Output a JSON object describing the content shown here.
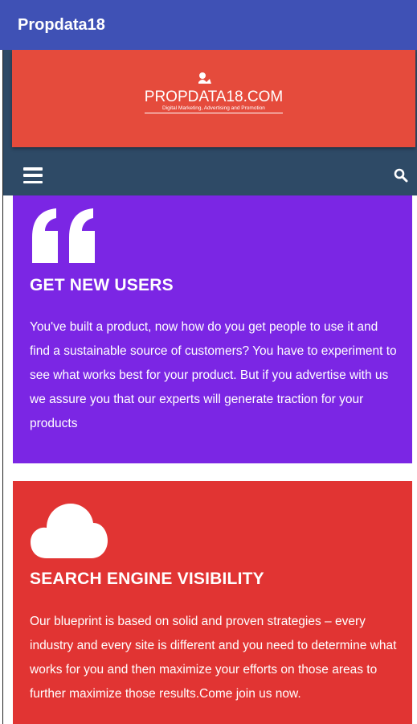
{
  "appbar": {
    "title": "Propdata18",
    "color": "#3f51b5"
  },
  "site": {
    "logo": {
      "text": "PROPDATA18.COM",
      "tagline": "Digital Marketing, Advertising and Promotion"
    },
    "banner_color": "#e54b3c",
    "nav_color": "#2e4a66",
    "nav": {
      "menu_icon": "hamburger-menu-icon",
      "search_icon": "search-icon"
    }
  },
  "cards": [
    {
      "icon": "quote-icon",
      "title": "GET NEW USERS",
      "body": "You've built a product, now how do you get people to use it and find a sustainable source of customers? You have to experiment to see what works best for your product. But if you advertise with us we assure you that our experts will generate traction for your products",
      "color": "#7b26e4"
    },
    {
      "icon": "cloud-icon",
      "title": "SEARCH ENGINE VISIBILITY",
      "body": "Our blueprint is based on solid and proven strategies – every industry and every site is different and you need to determine what works for you and then maximize your efforts on those areas to further maximize those results.Come join us now.",
      "color": "#e13433"
    }
  ]
}
